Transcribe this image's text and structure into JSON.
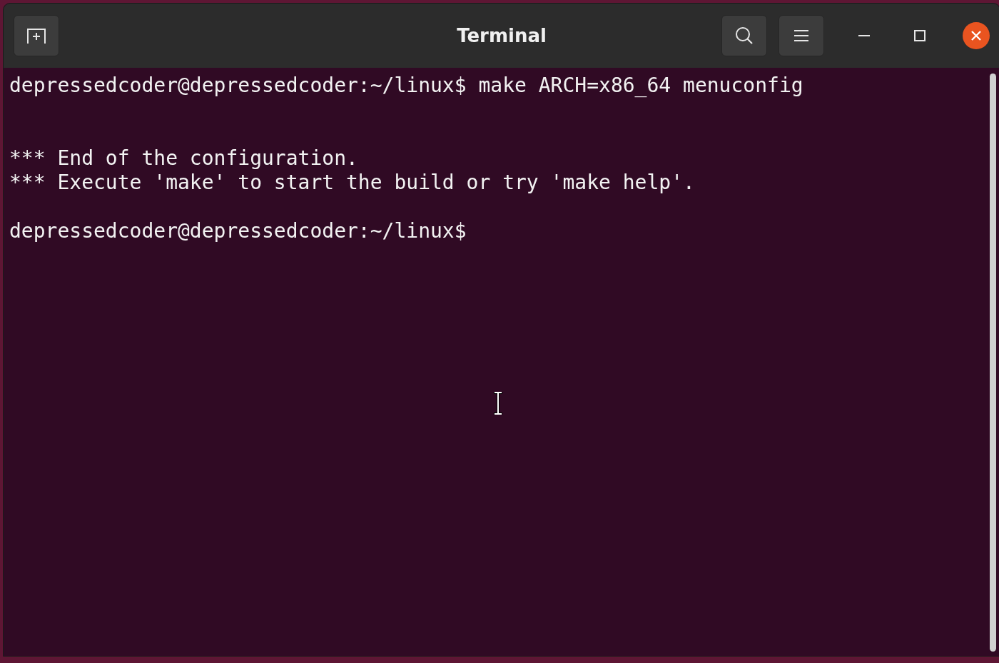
{
  "window": {
    "title": "Terminal"
  },
  "lines": [
    {
      "kind": "prompt",
      "prompt": "depressedcoder@depressedcoder:~/linux$",
      "command": "make ARCH=x86_64 menuconfig"
    },
    {
      "kind": "blank"
    },
    {
      "kind": "blank"
    },
    {
      "kind": "output",
      "text": "*** End of the configuration."
    },
    {
      "kind": "output",
      "text": "*** Execute 'make' to start the build or try 'make help'."
    },
    {
      "kind": "blank"
    },
    {
      "kind": "prompt",
      "prompt": "depressedcoder@depressedcoder:~/linux$"
    }
  ]
}
